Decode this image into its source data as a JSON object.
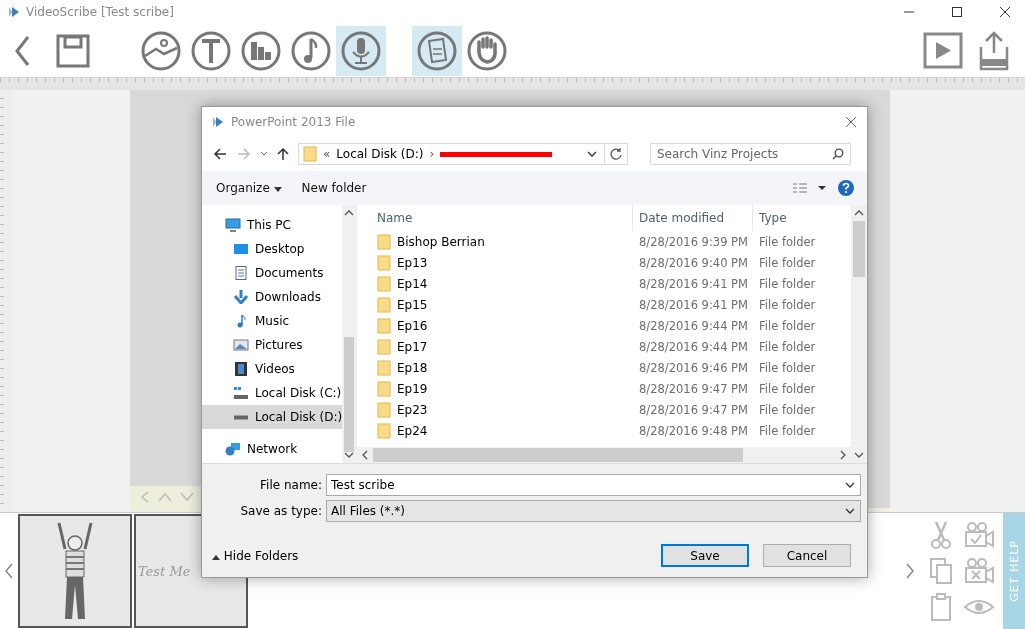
{
  "window": {
    "title": "VideoScribe [Test scribe]"
  },
  "toolbar": {
    "left": [
      {
        "kind": "back",
        "selected": false
      },
      {
        "kind": "save",
        "selected": false
      }
    ],
    "tools": [
      {
        "kind": "image",
        "selected": false
      },
      {
        "kind": "text",
        "selected": false
      },
      {
        "kind": "chart",
        "selected": false
      },
      {
        "kind": "music",
        "selected": false
      },
      {
        "kind": "mic",
        "selected": true
      },
      {
        "kind": "gap"
      },
      {
        "kind": "doc",
        "selected": true
      },
      {
        "kind": "hand",
        "selected": false
      }
    ],
    "right": [
      {
        "kind": "play"
      },
      {
        "kind": "export"
      }
    ]
  },
  "dialog": {
    "title": "PowerPoint 2013 File",
    "breadcrumb": [
      "«",
      "Local Disk (D:)",
      "›"
    ],
    "breadcrumb_redacted": true,
    "search": {
      "placeholder": "Search Vinz Projects"
    },
    "commands": [
      "Organize",
      "New folder"
    ],
    "nav": [
      {
        "label": "This PC",
        "kind": "pc",
        "selected": false,
        "children": [
          {
            "label": "Desktop",
            "kind": "desktop",
            "selected": false
          },
          {
            "label": "Documents",
            "kind": "documents",
            "selected": false
          },
          {
            "label": "Downloads",
            "kind": "downloads",
            "selected": false
          },
          {
            "label": "Music",
            "kind": "music",
            "selected": false
          },
          {
            "label": "Pictures",
            "kind": "pictures",
            "selected": false
          },
          {
            "label": "Videos",
            "kind": "videos",
            "selected": false
          },
          {
            "label": "Local Disk (C:)",
            "kind": "diskc",
            "selected": false
          },
          {
            "label": "Local Disk (D:)",
            "kind": "disk",
            "selected": true
          }
        ]
      },
      {
        "label": "Network",
        "kind": "network",
        "selected": false
      }
    ],
    "columns": [
      "Name",
      "Date modified",
      "Type"
    ],
    "rows": [
      {
        "name": "Bishop Berrian",
        "date": "8/28/2016 9:39 PM",
        "type": "File folder"
      },
      {
        "name": "Ep13",
        "date": "8/28/2016 9:40 PM",
        "type": "File folder"
      },
      {
        "name": "Ep14",
        "date": "8/28/2016 9:41 PM",
        "type": "File folder"
      },
      {
        "name": "Ep15",
        "date": "8/28/2016 9:41 PM",
        "type": "File folder"
      },
      {
        "name": "Ep16",
        "date": "8/28/2016 9:44 PM",
        "type": "File folder"
      },
      {
        "name": "Ep17",
        "date": "8/28/2016 9:44 PM",
        "type": "File folder"
      },
      {
        "name": "Ep18",
        "date": "8/28/2016 9:46 PM",
        "type": "File folder"
      },
      {
        "name": "Ep19",
        "date": "8/28/2016 9:47 PM",
        "type": "File folder"
      },
      {
        "name": "Ep23",
        "date": "8/28/2016 9:47 PM",
        "type": "File folder"
      },
      {
        "name": "Ep24",
        "date": "8/28/2016 9:48 PM",
        "type": "File folder"
      }
    ],
    "file_name": {
      "label": "File name:",
      "value": "Test scribe"
    },
    "save_type": {
      "label": "Save as type:",
      "value": "All Files (*.*)"
    },
    "hide_folders": "Hide Folders",
    "buttons": [
      "Save",
      "Cancel"
    ]
  },
  "timeline": {
    "thumbs": [
      {
        "kind": "figure"
      },
      {
        "kind": "text",
        "text": "Test Me"
      }
    ],
    "help": "GET HELP"
  }
}
